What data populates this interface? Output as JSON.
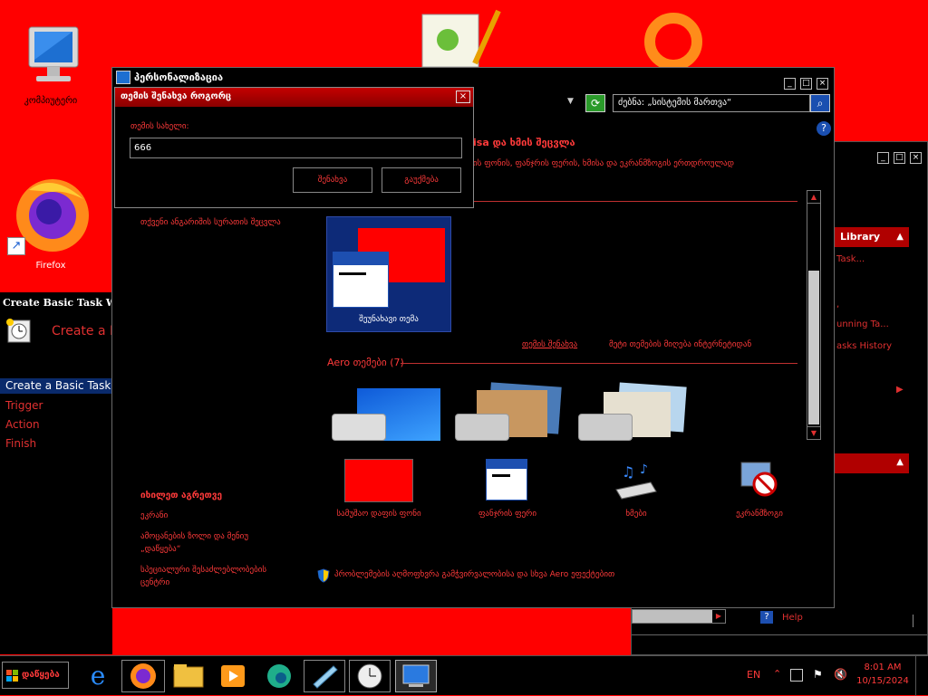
{
  "colors": {
    "desktop": "#ff0000",
    "window_bg": "#000000",
    "accent": "#ff3030",
    "title_red": "#c00000"
  },
  "desktop": {
    "icons": [
      {
        "name": "computer-icon",
        "label": "კომპიუტერი"
      },
      {
        "name": "firefox-icon",
        "label": "Firefox"
      }
    ]
  },
  "left_wizard": {
    "title": "Create Basic Task Wi",
    "heading": "Create a B",
    "steps": [
      "Create a Basic Task",
      "Trigger",
      "Action",
      "Finish"
    ]
  },
  "right_window": {
    "header": "Library",
    "items": [
      "Task...",
      "",
      ",",
      "unning Ta...",
      "asks History"
    ],
    "help": "Help"
  },
  "personalization": {
    "title": "პერსონალიზაცია",
    "search_placeholder": "ძებნა: „სისტემის მართვა“",
    "heading": "isa და ხმის შეცვლა",
    "subheading": "ის ფონის, ფანჯრის ფერის, ხმისა და ეკრანმზოგის ერთდროულად",
    "side_link": "თქვენი ანგარიშის სურათის შეცვლა",
    "unsaved_theme": "შეუნახავი თემა",
    "save_theme_link": "თემის შენახვა",
    "online_link": "მეტი თემების მიღება ინტერნეტიდან",
    "aero_label": "Aero თემები (7)",
    "see_also": "იხილეთ აგრეთვე",
    "see_also_links": [
      "ეკრანი",
      "ამოცანების ზოლი და მენიუ „დაწყება“",
      "სპეციალური შესაძლებლობების ცენტრი"
    ],
    "bottom_items": [
      "სამუშაო დაფის ფონი",
      "ფანჯრის ფერი",
      "ხმები",
      "ეკრანმზოგი"
    ],
    "troubleshoot": "პრობლემების აღმოფხვრა გამჭვირვალობისა და სხვა Aero ეფექტებით"
  },
  "dialog": {
    "title": "თემის შენახვა როგორც",
    "field_label": "თემის სახელი:",
    "field_value": "666",
    "save": "შენახვა",
    "cancel": "გაუქმება"
  },
  "taskbar": {
    "start": "დაწყება",
    "lang": "EN",
    "time": "8:01 AM",
    "date": "10/15/2024"
  }
}
